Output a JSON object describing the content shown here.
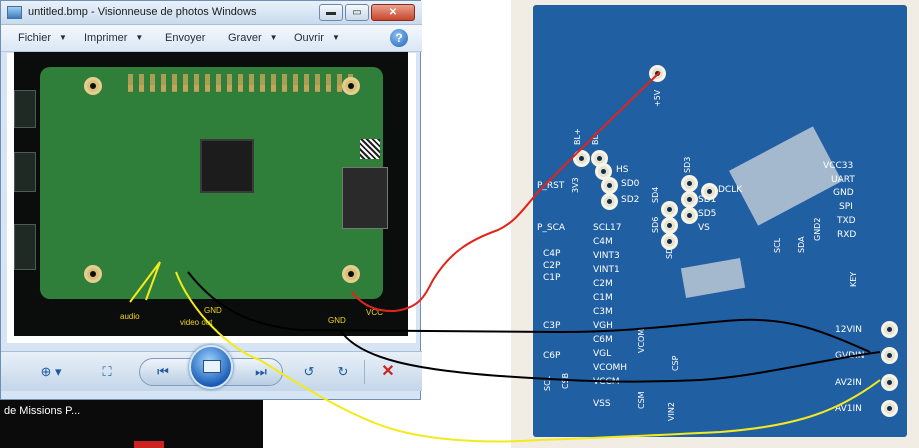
{
  "viewer": {
    "title": "untitled.bmp - Visionneuse de photos Windows",
    "window_buttons": {
      "minimize": "▬",
      "maximize": "▭",
      "close": "✕"
    },
    "menu": [
      {
        "label": "Fichier",
        "has_dropdown": true
      },
      {
        "label": "Imprimer",
        "has_dropdown": true
      },
      {
        "label": "Envoyer",
        "has_dropdown": false
      },
      {
        "label": "Graver",
        "has_dropdown": true
      },
      {
        "label": "Ouvrir",
        "has_dropdown": true
      }
    ],
    "help_label": "?",
    "photo_labels": {
      "audio": "audio",
      "video_out": "video out",
      "gnd_top": "GND",
      "gnd": "GND",
      "vcc": "VCC"
    },
    "toolbar": {
      "zoom_icon": "magnifier-icon",
      "fit_icon": "fit-window-icon",
      "prev_icon": "previous-icon",
      "slideshow_icon": "slideshow-icon",
      "next_icon": "next-icon",
      "rotate_left_icon": "rotate-left-icon",
      "rotate_right_icon": "rotate-right-icon",
      "delete_icon": "delete-icon"
    }
  },
  "background_window": {
    "text": "de Missions P..."
  },
  "board": {
    "labels": {
      "plus5v": "+5V",
      "bl_plus": "BL+",
      "bl_minus": "BL-",
      "hs": "HS",
      "v3v3": "3V3",
      "sd0": "SD0",
      "sd2": "SD2",
      "sd3": "SD3",
      "sd1": "SD1",
      "sd5": "SD5",
      "vs": "VS",
      "sd4": "SD4",
      "sd6": "SD6",
      "sd7": "SD7",
      "dclk": "DCLK",
      "p_rst": "P_RST",
      "p_sca": "P_SCA",
      "scl17": "SCL17",
      "c4m": "C4M",
      "vint3": "VINT3",
      "vint1": "VINT1",
      "c2m": "C2M",
      "c1m": "C1M",
      "c3m": "C3M",
      "vgh": "VGH",
      "c5m": "C6M",
      "vgl": "VGL",
      "vcomh": "VCOMH",
      "vccm": "VCCM",
      "c4p": "C4P",
      "c2p": "C2P",
      "c1p": "C1P",
      "c3p": "C3P",
      "c6p": "C6P",
      "csb": "CSB",
      "scl": "SCL",
      "vcom": "VCOM",
      "csp": "CSP",
      "csm": "CSM",
      "vin2": "VIN2",
      "vss": "VSS",
      "scl_b": "SCL",
      "sda": "SDA",
      "gnd2": "GND2",
      "key": "KEY",
      "vcc33": "VCC33",
      "uart": "UART",
      "gnd": "GND",
      "spi": "SPI",
      "txd": "TXD",
      "rxd": "RXD",
      "v12vin": "12VIN",
      "gvdin": "GVDIN",
      "av2in": "AV2IN",
      "av1in": "AV1IN"
    }
  },
  "wire_colors": {
    "red": "#e2231a",
    "black": "#000000",
    "yellow": "#f3ea1c"
  }
}
